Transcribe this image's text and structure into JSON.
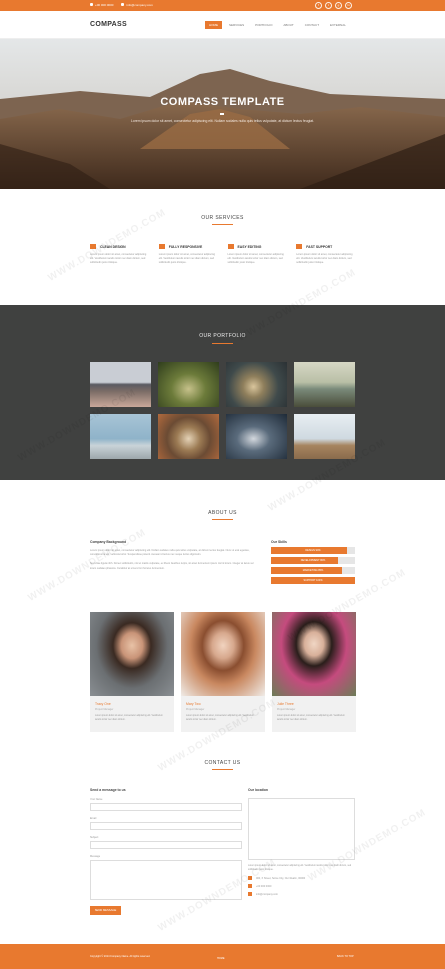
{
  "topbar": {
    "phone": "+00 000 0000",
    "email": "info@company.com",
    "socials": [
      "f",
      "t",
      "g",
      "in"
    ]
  },
  "navbar": {
    "logo": "COMPASS",
    "items": [
      {
        "label": "HOME",
        "active": true
      },
      {
        "label": "SERVICES",
        "active": false
      },
      {
        "label": "PORTFOLIO",
        "active": false
      },
      {
        "label": "ABOUT",
        "active": false
      },
      {
        "label": "CONTACT",
        "active": false
      },
      {
        "label": "EXTERNAL",
        "active": false
      }
    ]
  },
  "hero": {
    "title": "COMPASS TEMPLATE",
    "subtitle": "Lorem ipsum dolor sit amet, consectetur adipiscing elit. Nullam sodales nulla quis tellus vulputate, at dictum lectus feugiat."
  },
  "services": {
    "title": "OUR SERVICES",
    "items": [
      {
        "label": "CLEAN DESIGN",
        "text": "Lorem ipsum dolor sit amet, consectetur adipiscing elit. Vestibulum iaculis tortor nec diam dictum, sed sollicitudin justo tristique."
      },
      {
        "label": "FULLY RESPONSIVE",
        "text": "Lorem ipsum dolor sit amet, consectetur adipiscing elit. Vestibulum iaculis tortor nec diam dictum, sed sollicitudin justo tristique."
      },
      {
        "label": "EASY EDITING",
        "text": "Lorem ipsum dolor sit amet, consectetur adipiscing elit. Vestibulum iaculis tortor nec diam dictum, sed sollicitudin justo tristique."
      },
      {
        "label": "FAST SUPPORT",
        "text": "Lorem ipsum dolor sit amet, consectetur adipiscing elit. Vestibulum iaculis tortor nec diam dictum, sed sollicitudin justo tristique."
      }
    ]
  },
  "portfolio": {
    "title": "OUR PORTFOLIO",
    "items": [
      "city",
      "trees",
      "cup",
      "sea",
      "pier",
      "coffee",
      "phone",
      "desk"
    ]
  },
  "about": {
    "title": "ABOUT US",
    "background_heading": "Company Background",
    "para1": "Lorem ipsum dolor sit amet, consectetur adipiscing elit. Nullam sodales nulla quis tellus vulputate, at dictum lectus feugiat. Nunc ut erat egestas, convallis urna vel, vehicula tortor. Suspendisse potenti. Aenean id lectus nec neque luctus dignissim.",
    "para2": "Sed vitae ligula nibh. Donec sollicitudin, nisl et mattis vulputate, ex libero faucibus turpis, sit amet fermentum ipsum nisl id lorem. Integer at lacus vel lorem sodales pharetra. Curabitur at urna id mi rhoncus fermentum.",
    "skills_heading": "Our Skills",
    "skills": [
      {
        "label": "DESIGN 90%",
        "value": 0.9
      },
      {
        "label": "DEVELOPMENT 80%",
        "value": 0.8
      },
      {
        "label": "MARKETING 85%",
        "value": 0.85
      },
      {
        "label": "SUPPORT 100%",
        "value": 1.0
      }
    ]
  },
  "team": [
    {
      "name": "Tracy One",
      "role": "Project Manager",
      "bio": "Lorem ipsum dolor sit amet, consectetur adipiscing elit. Vestibulum iaculis tortor nec diam dictum."
    },
    {
      "name": "Mary Two",
      "role": "Project Manager",
      "bio": "Lorem ipsum dolor sit amet, consectetur adipiscing elit. Vestibulum iaculis tortor nec diam dictum."
    },
    {
      "name": "Julie Three",
      "role": "Project Manager",
      "bio": "Lorem ipsum dolor sit amet, consectetur adipiscing elit. Vestibulum iaculis tortor nec diam dictum."
    }
  ],
  "contact": {
    "title": "CONTACT US",
    "form_heading": "Send a message to us",
    "name_label": "Your Name",
    "email_label": "Email",
    "subject_label": "Subject",
    "message_label": "Message",
    "submit_label": "SEND MESSAGE",
    "location_heading": "Our location",
    "location_text": "Lorem ipsum dolor sit amet, consectetur adipiscing elit. Vestibulum iaculis tortor nec diam dictum, sed sollicitudin justo tristique.",
    "address": "000, X Street, Some City, Our Realm, 00000",
    "phone": "+00 000 0000",
    "email": "info@company.com"
  },
  "footer": {
    "copyright": "Copyright © 2014 Company Name. All rights reserved.",
    "home": "HOME",
    "back_to_top": "BACK TO TOP"
  },
  "colors": {
    "accent": "#e8792f",
    "portfolio_bg": "#404140",
    "footer": "#e8792f"
  },
  "watermark": "WWW.DOWNDEMO.COM"
}
